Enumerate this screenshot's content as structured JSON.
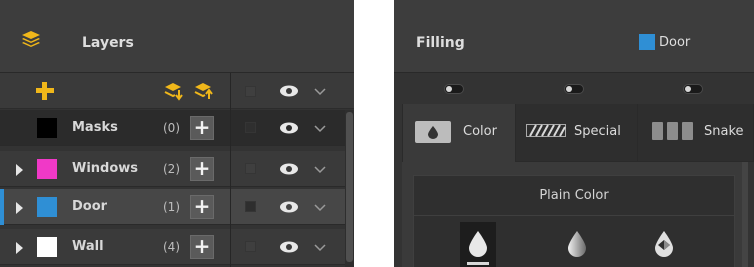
{
  "layers_panel": {
    "title": "Layers",
    "toolbar": {
      "add_layer_icon": "plus-icon",
      "move_down_icon": "move-layer-down-icon",
      "move_up_icon": "move-layer-up-icon"
    },
    "rows": [
      {
        "name": "Masks",
        "count": "(0)",
        "add_label": "+",
        "swatch": "#000000",
        "expandable": false,
        "selected": false
      },
      {
        "name": "Windows",
        "count": "(2)",
        "add_label": "+",
        "swatch": "#f039c7",
        "expandable": true,
        "selected": false
      },
      {
        "name": "Door",
        "count": "(1)",
        "add_label": "+",
        "swatch": "#2f8fd5",
        "expandable": true,
        "selected": true
      },
      {
        "name": "Wall",
        "count": "(4)",
        "add_label": "+",
        "swatch": "#ffffff",
        "expandable": true,
        "selected": false
      }
    ],
    "colors": {
      "accent": "#f0b71a",
      "selection": "#2f8fd5"
    }
  },
  "filling_panel": {
    "title": "Filling",
    "target_name": "Door",
    "target_color": "#2f8fd5",
    "tabs": [
      {
        "label": "Color",
        "icon": "drop-icon",
        "active": true
      },
      {
        "label": "Special",
        "icon": "hatch-pattern-icon",
        "active": false
      },
      {
        "label": "Snake",
        "icon": "snake-pattern-icon",
        "active": false
      }
    ],
    "section_title": "Plain Color",
    "fill_options": [
      "drop-solid-icon",
      "drop-gradient-icon",
      "drop-transparent-icon"
    ]
  }
}
